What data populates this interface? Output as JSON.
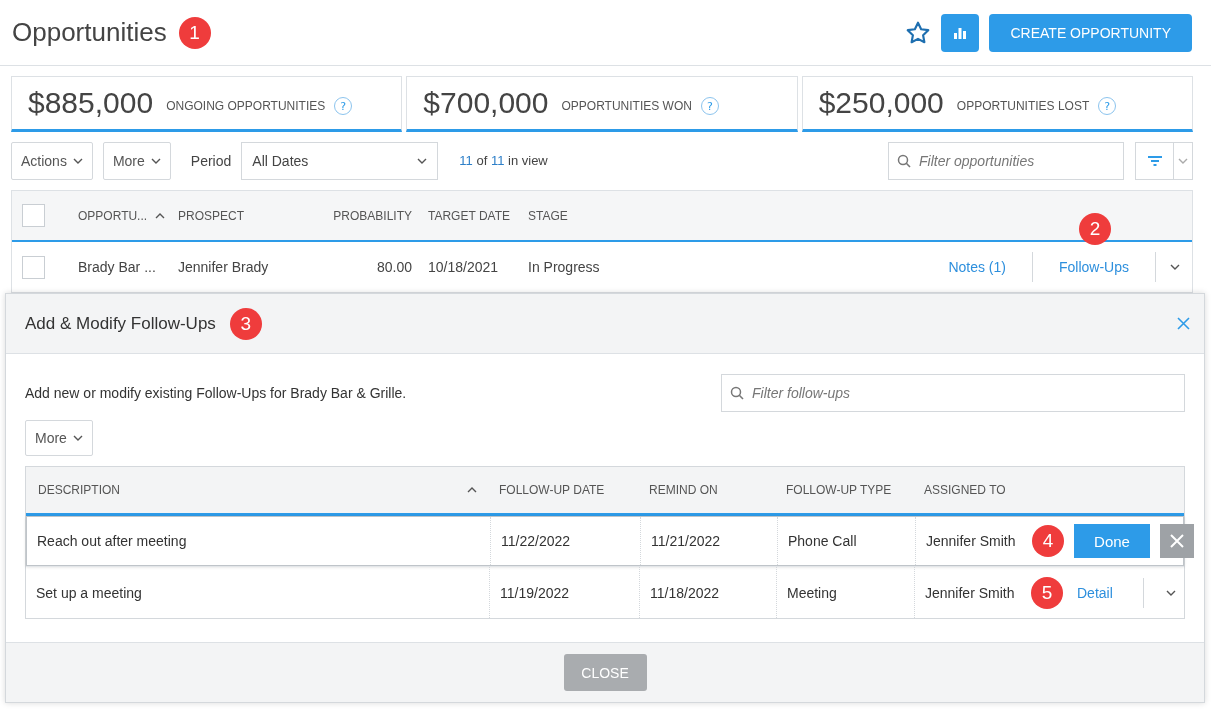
{
  "header": {
    "title": "Opportunities",
    "badge": "1",
    "create_button": "CREATE OPPORTUNITY"
  },
  "stats": [
    {
      "amount": "$885,000",
      "label": "ONGOING OPPORTUNITIES",
      "help": "?"
    },
    {
      "amount": "$700,000",
      "label": "OPPORTUNITIES WON",
      "help": "?"
    },
    {
      "amount": "$250,000",
      "label": "OPPORTUNITIES LOST",
      "help": "?"
    }
  ],
  "toolbar": {
    "actions": "Actions",
    "more": "More",
    "period_label": "Period",
    "period_value": "All Dates",
    "count": {
      "shown": "11",
      "of": "of",
      "total": "11",
      "suffix": "in view"
    },
    "filter_placeholder": "Filter opportunities"
  },
  "table": {
    "select_all_checked": false,
    "columns": [
      {
        "label": "OPPORTU...",
        "sorted": true
      },
      {
        "label": "PROSPECT",
        "sorted": false
      },
      {
        "label": "PROBABILITY",
        "sorted": false
      },
      {
        "label": "TARGET DATE",
        "sorted": false
      },
      {
        "label": "STAGE",
        "sorted": false
      }
    ],
    "rows": [
      {
        "checked": false,
        "cells": [
          "Brady Bar ...",
          "Jennifer Brady",
          "80.00",
          "10/18/2021",
          "In Progress"
        ],
        "notes": "Notes (1)",
        "follow_ups": "Follow-Ups",
        "badge": "2"
      }
    ]
  },
  "modal": {
    "title": "Add & Modify Follow-Ups",
    "badge": "3",
    "description": "Add new or modify existing Follow-Ups for Brady Bar & Grille.",
    "filter_placeholder": "Filter follow-ups",
    "more": "More",
    "columns": [
      {
        "label": "DESCRIPTION",
        "sorted": true
      },
      {
        "label": "FOLLOW-UP DATE",
        "sorted": false
      },
      {
        "label": "REMIND ON",
        "sorted": false
      },
      {
        "label": "FOLLOW-UP TYPE",
        "sorted": false
      },
      {
        "label": "ASSIGNED TO",
        "sorted": false
      }
    ],
    "rows": [
      {
        "kind": "editing",
        "cells": [
          "Reach out after meeting",
          "11/22/2022",
          "11/21/2022",
          "Phone Call",
          "Jennifer Smith"
        ],
        "badge": "4",
        "action": "Done"
      },
      {
        "kind": "normal",
        "cells": [
          "Set up a meeting",
          "11/19/2022",
          "11/18/2022",
          "Meeting",
          "Jennifer Smith"
        ],
        "badge": "5",
        "action": "Detail"
      }
    ],
    "close_button": "CLOSE"
  }
}
